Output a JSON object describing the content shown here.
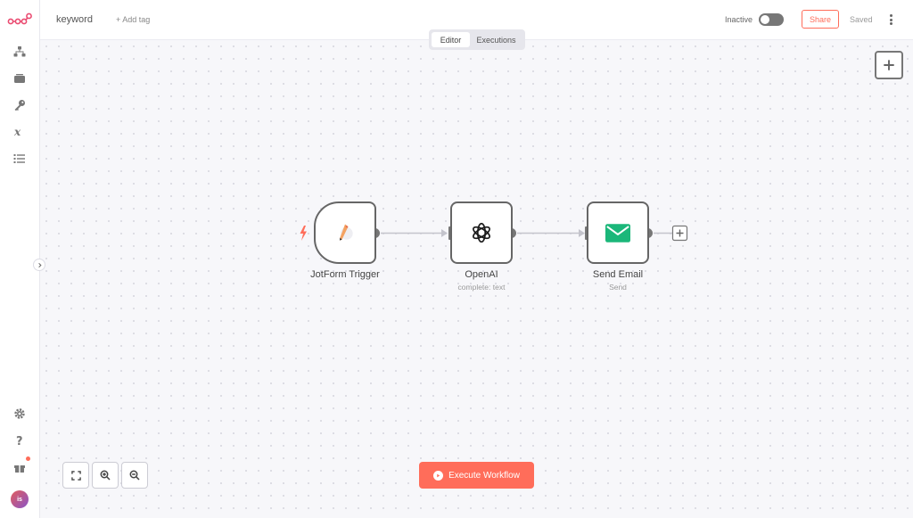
{
  "header": {
    "workflow_name": "keyword",
    "add_tag_label": "+ Add tag",
    "active_status_label": "Inactive",
    "share_label": "Share",
    "save_status": "Saved"
  },
  "tabs": [
    {
      "label": "Editor",
      "active": true
    },
    {
      "label": "Executions",
      "active": false
    }
  ],
  "sidebar": {
    "top_items": [
      {
        "icon": "workflows-icon"
      },
      {
        "icon": "templates-icon"
      },
      {
        "icon": "credentials-icon"
      },
      {
        "icon": "variables-icon"
      },
      {
        "icon": "executions-icon"
      }
    ],
    "bottom_items": [
      {
        "icon": "settings-icon"
      },
      {
        "icon": "help-icon"
      },
      {
        "icon": "whats-new-icon"
      }
    ],
    "user_initials": "is"
  },
  "nodes": [
    {
      "name": "JotForm Trigger",
      "subtitle": "",
      "icon": "jotform-icon",
      "type": "trigger"
    },
    {
      "name": "OpenAI",
      "subtitle": "complete: text",
      "icon": "openai-icon",
      "type": "action"
    },
    {
      "name": "Send Email",
      "subtitle": "Send",
      "icon": "email-icon",
      "type": "action"
    }
  ],
  "execute_button_label": "Execute Workflow",
  "colors": {
    "accent": "#ff6d5a",
    "email_green": "#1bb77a",
    "node_border": "#666666",
    "canvas_bg": "#f7f7fa"
  }
}
